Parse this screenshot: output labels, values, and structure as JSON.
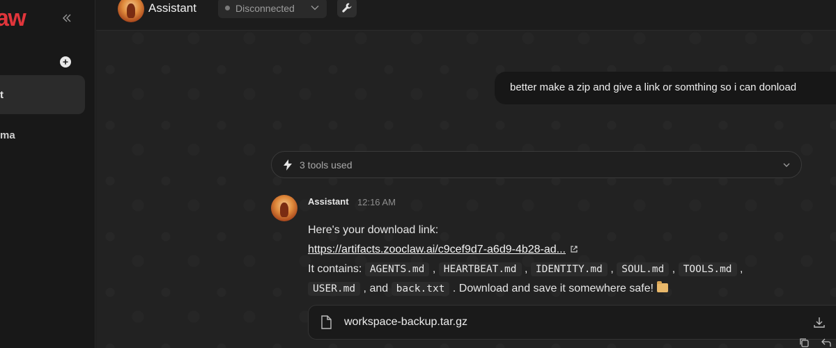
{
  "sidebar": {
    "logo_text": "aw",
    "items": [
      {
        "label": "t"
      },
      {
        "label": "ma"
      }
    ]
  },
  "header": {
    "title": "Assistant",
    "status": "Disconnected"
  },
  "chat": {
    "user_message": "better make a zip and give a link or somthing so i can donload",
    "tools_used": "3 tools used",
    "assistant": {
      "author": "Assistant",
      "time": "12:16 AM",
      "intro": "Here's your download link:",
      "link": "https://artifacts.zooclaw.ai/c9cef9d7-a6d9-4b28-ad...",
      "contains_prefix": "It contains:",
      "files": [
        "AGENTS.md",
        "HEARTBEAT.md",
        "IDENTITY.md",
        "SOUL.md",
        "TOOLS.md",
        "USER.md",
        "back.txt"
      ],
      "and_word": "and",
      "outro": ". Download and save it somewhere safe!",
      "attachment": "workspace-backup.tar.gz"
    }
  },
  "colors": {
    "brand": "#e0353b",
    "background": "#222222",
    "sidebar": "#181818"
  },
  "icons": [
    "collapse-icon",
    "plus-icon",
    "chevron-down-icon",
    "wrench-icon",
    "lightning-icon",
    "external-link-icon",
    "folder-emoji-icon",
    "file-icon",
    "download-icon",
    "copy-icon",
    "reply-icon"
  ]
}
